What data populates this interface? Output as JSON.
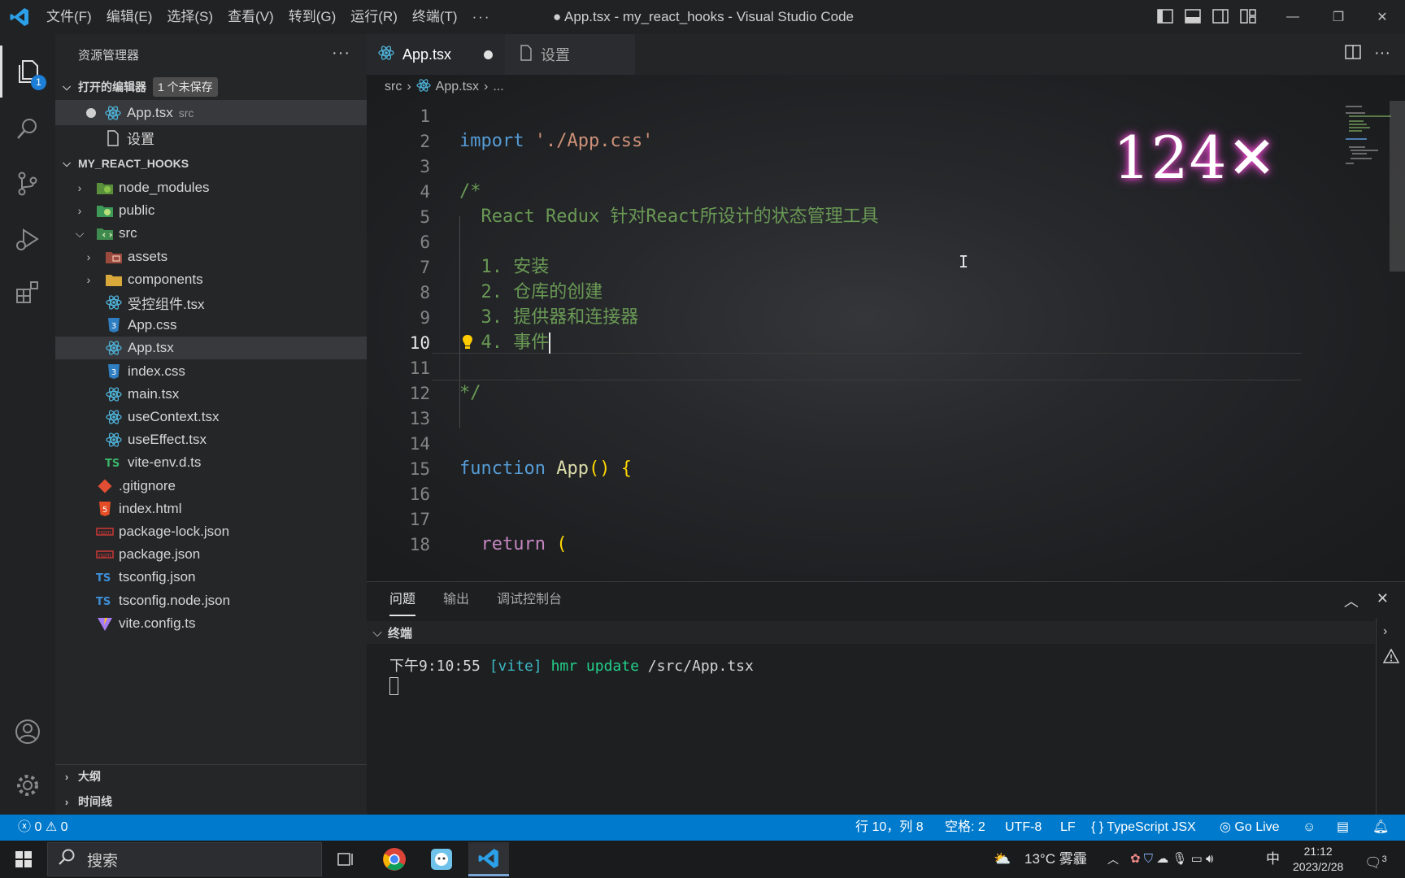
{
  "titlebar": {
    "menus": [
      "文件(F)",
      "编辑(E)",
      "选择(S)",
      "查看(V)",
      "转到(G)",
      "运行(R)",
      "终端(T)",
      "···"
    ],
    "window_title": "● App.tsx - my_react_hooks - Visual Studio Code"
  },
  "activitybar": {
    "explorer_badge": "1"
  },
  "sidebar": {
    "title": "资源管理器",
    "open_editors": {
      "label": "打开的编辑器",
      "badge": "1 个未保存",
      "items": [
        {
          "name": "App.tsx",
          "hint": "src"
        },
        {
          "name": "设置"
        }
      ]
    },
    "project": {
      "label": "MY_REACT_HOOKS",
      "items": [
        {
          "name": "node_modules"
        },
        {
          "name": "public"
        },
        {
          "name": "src"
        },
        {
          "name": "assets"
        },
        {
          "name": "components"
        },
        {
          "name": "受控组件.tsx"
        },
        {
          "name": "App.css"
        },
        {
          "name": "App.tsx"
        },
        {
          "name": "index.css"
        },
        {
          "name": "main.tsx"
        },
        {
          "name": "useContext.tsx"
        },
        {
          "name": "useEffect.tsx"
        },
        {
          "name": "vite-env.d.ts"
        },
        {
          "name": ".gitignore"
        },
        {
          "name": "index.html"
        },
        {
          "name": "package-lock.json"
        },
        {
          "name": "package.json"
        },
        {
          "name": "tsconfig.json"
        },
        {
          "name": "tsconfig.node.json"
        },
        {
          "name": "vite.config.ts"
        }
      ]
    },
    "outline_label": "大纲",
    "timeline_label": "时间线"
  },
  "editor": {
    "tabs": [
      {
        "label": "App.tsx",
        "modified": true
      },
      {
        "label": "设置"
      }
    ],
    "breadcrumb": {
      "folder": "src",
      "file": "App.tsx",
      "more": "..."
    },
    "speed_overlay": "124✕",
    "lines": [
      {
        "n": "1",
        "text": ""
      },
      {
        "n": "2",
        "kw": "import",
        "str": "'./App.css'"
      },
      {
        "n": "3",
        "text": ""
      },
      {
        "n": "4",
        "cm": "/*"
      },
      {
        "n": "5",
        "cm": "  React Redux 针对React所设计的状态管理工具"
      },
      {
        "n": "6",
        "text": ""
      },
      {
        "n": "7",
        "cm": "  1. 安装"
      },
      {
        "n": "8",
        "cm": "  2. 仓库的创建"
      },
      {
        "n": "9",
        "cm": "  3. 提供器和连接器"
      },
      {
        "n": "10",
        "cm": "  4. 事件"
      },
      {
        "n": "11",
        "text": ""
      },
      {
        "n": "12",
        "cm": "*/"
      },
      {
        "n": "13",
        "text": ""
      },
      {
        "n": "14",
        "text": ""
      },
      {
        "n": "15",
        "kw": "function",
        "fn": "App",
        "tail": "() {"
      },
      {
        "n": "16",
        "text": ""
      },
      {
        "n": "17",
        "text": ""
      },
      {
        "n": "18",
        "kw2": "  return",
        "tail": " ("
      }
    ],
    "current_line": "10"
  },
  "panel": {
    "tabs": [
      "问题",
      "输出",
      "调试控制台"
    ],
    "terminal_label": "终端",
    "terminal_line": {
      "time": "下午9:10:55",
      "tag": "[vite]",
      "msg": "hmr update",
      "path": "/src/App.tsx"
    }
  },
  "statusbar": {
    "errors": "0",
    "warnings": "0",
    "position": "行 10，列 8",
    "spaces": "空格: 2",
    "encoding": "UTF-8",
    "eol": "LF",
    "language": "TypeScript JSX",
    "golive": "Go Live"
  },
  "taskbar": {
    "search_placeholder": "搜索",
    "weather": "13°C 雾霾",
    "ime": "中",
    "time": "21:12",
    "date": "2023/2/28",
    "notifications": "3"
  }
}
